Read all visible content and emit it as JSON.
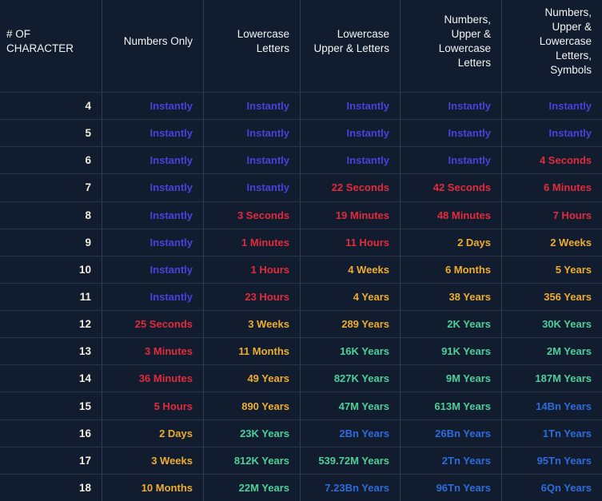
{
  "colors": {
    "instant": "#4c40dc",
    "danger": "#e22b3d",
    "warning": "#eead2e",
    "safe": "#4ecf99",
    "secure": "#2e6cdb",
    "background": "#111c2e",
    "grid_line_vertical": "#2e3c55",
    "grid_line_horizontal": "#273447",
    "header_text": "#f4f4f4",
    "row_number_text": "#f3eedd"
  },
  "chart_data": {
    "type": "table",
    "row_header": "# OF\nCHARACTER",
    "categories": [
      "4",
      "5",
      "6",
      "7",
      "8",
      "9",
      "10",
      "11",
      "12",
      "13",
      "14",
      "15",
      "16",
      "17",
      "18"
    ],
    "series": [
      {
        "name": "Numbers Only",
        "label": "Numbers Only",
        "values": [
          "Instantly",
          "Instantly",
          "Instantly",
          "Instantly",
          "Instantly",
          "Instantly",
          "Instantly",
          "Instantly",
          "25 Seconds",
          "3 Minutes",
          "36 Minutes",
          "5 Hours",
          "2 Days",
          "3 Weeks",
          "10 Months"
        ],
        "tones": [
          "instant",
          "instant",
          "instant",
          "instant",
          "instant",
          "instant",
          "instant",
          "instant",
          "danger",
          "danger",
          "danger",
          "danger",
          "warning",
          "warning",
          "warning"
        ]
      },
      {
        "name": "Lowercase Letters",
        "label": "Lowercase\nLetters",
        "values": [
          "Instantly",
          "Instantly",
          "Instantly",
          "Instantly",
          "3 Seconds",
          "1 Minutes",
          "1 Hours",
          "23 Hours",
          "3 Weeks",
          "11 Months",
          "49 Years",
          "890 Years",
          "23K Years",
          "812K Years",
          "22M Years"
        ],
        "tones": [
          "instant",
          "instant",
          "instant",
          "instant",
          "danger",
          "danger",
          "danger",
          "danger",
          "warning",
          "warning",
          "warning",
          "warning",
          "safe",
          "safe",
          "safe"
        ]
      },
      {
        "name": "Lowercase Upper & Letters",
        "label": "Lowercase\nUpper & Letters",
        "values": [
          "Instantly",
          "Instantly",
          "Instantly",
          "22 Seconds",
          "19 Minutes",
          "11 Hours",
          "4 Weeks",
          "4 Years",
          "289 Years",
          "16K Years",
          "827K Years",
          "47M Years",
          "2Bn Years",
          "539.72M Years",
          "7.23Bn Years"
        ],
        "tones": [
          "instant",
          "instant",
          "instant",
          "danger",
          "danger",
          "danger",
          "warning",
          "warning",
          "warning",
          "safe",
          "safe",
          "safe",
          "secure",
          "safe",
          "secure"
        ]
      },
      {
        "name": "Numbers, Upper & Lowercase Letters",
        "label": "Numbers,\nUpper &\nLowercase\nLetters",
        "values": [
          "Instantly",
          "Instantly",
          "Instantly",
          "42 Seconds",
          "48 Minutes",
          "2 Days",
          "6 Months",
          "38 Years",
          "2K Years",
          "91K Years",
          "9M Years",
          "613M Years",
          "26Bn Years",
          "2Tn Years",
          "96Tn Years"
        ],
        "tones": [
          "instant",
          "instant",
          "instant",
          "danger",
          "danger",
          "warning",
          "warning",
          "warning",
          "safe",
          "safe",
          "safe",
          "safe",
          "secure",
          "secure",
          "secure"
        ]
      },
      {
        "name": "Numbers, Upper & Lowercase Letters, Symbols",
        "label": "Numbers,\nUpper &\nLowercase\nLetters,\nSymbols",
        "values": [
          "Instantly",
          "Instantly",
          "4 Seconds",
          "6 Minutes",
          "7 Hours",
          "2 Weeks",
          "5 Years",
          "356 Years",
          "30K Years",
          "2M Years",
          "187M Years",
          "14Bn Years",
          "1Tn Years",
          "95Tn Years",
          "6Qn Years"
        ],
        "tones": [
          "instant",
          "instant",
          "danger",
          "danger",
          "danger",
          "warning",
          "warning",
          "warning",
          "safe",
          "safe",
          "safe",
          "secure",
          "secure",
          "secure",
          "secure"
        ]
      }
    ]
  }
}
